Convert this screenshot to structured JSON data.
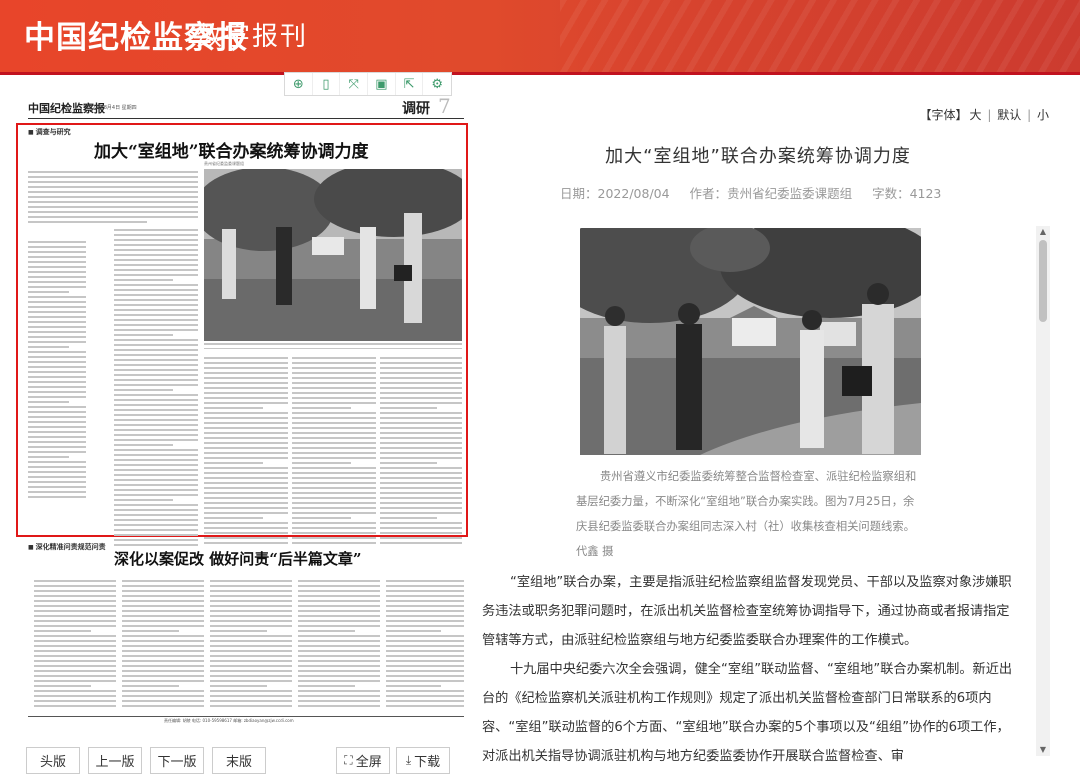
{
  "header": {
    "logo": "中国纪检监察报",
    "subtitle": "数字报刊"
  },
  "toolbar": {
    "buttons": [
      {
        "name": "zoom-icon",
        "glyph": "⊕"
      },
      {
        "name": "page-icon",
        "glyph": "▯"
      },
      {
        "name": "fit-icon",
        "glyph": "⤧"
      },
      {
        "name": "save-icon",
        "glyph": "▣"
      },
      {
        "name": "share-icon",
        "glyph": "⇱"
      },
      {
        "name": "settings-icon",
        "glyph": "⚙"
      }
    ]
  },
  "newspaper": {
    "masthead": "中国纪检监察报",
    "date": "2022年8月4日  星期四",
    "section": "调研",
    "page_number": "7",
    "tag_a": "调查与研究",
    "headline_a": "加大“室组地”联合办案统筹协调力度",
    "byline_a": "贵州省纪委监委课题组",
    "tag_b": "深化精准问责规范问责",
    "headline_b": "深化以案促改  做好问责“后半篇文章”",
    "footer": "责任编辑: 胡陵  电话: 010-59598617  邮箱: zbdiaoyan@zjw.ccdi.com"
  },
  "font_bar": {
    "label": "【字体】",
    "large": "大",
    "default": "默认",
    "small": "小"
  },
  "article": {
    "title": "加大“室组地”联合办案统筹协调力度",
    "date_label": "日期：",
    "date": "2022/08/04",
    "author_label": "作者：",
    "author": "贵州省纪委监委课题组",
    "wordcount_label": "字数：",
    "wordcount": "4123",
    "caption": "贵州省遵义市纪委监委统筹整合监督检查室、派驻纪检监察组和基层纪委力量，不断深化“室组地”联合办案实践。图为7月25日，余庆县纪委监委联合办案组同志深入村（社）收集核查相关问题线索。代鑫 摄",
    "para1": "“室组地”联合办案，主要是指派驻纪检监察组监督发现党员、干部以及监察对象涉嫌职务违法或职务犯罪问题时，在派出机关监督检查室统筹协调指导下，通过协商或者报请指定管辖等方式，由派驻纪检监察组与地方纪委监委联合办理案件的工作模式。",
    "para2": "十九届中央纪委六次全会强调，健全“室组”联动监督、“室组地”联合办案机制。新近出台的《纪检监察机关派驻机构工作规则》规定了派出机关监督检查部门日常联系的6项内容、“室组”联动监督的6个方面、“室组地”联合办案的5个事项以及“组组”协作的6项工作，对派出机关指导协调派驻机构与地方纪委监委协作开展联合监督检查、审"
  },
  "bottom_nav": {
    "first": "头版",
    "prev": "上一版",
    "next": "下一版",
    "last": "末版",
    "fullscreen": "全屏",
    "download": "下载"
  }
}
